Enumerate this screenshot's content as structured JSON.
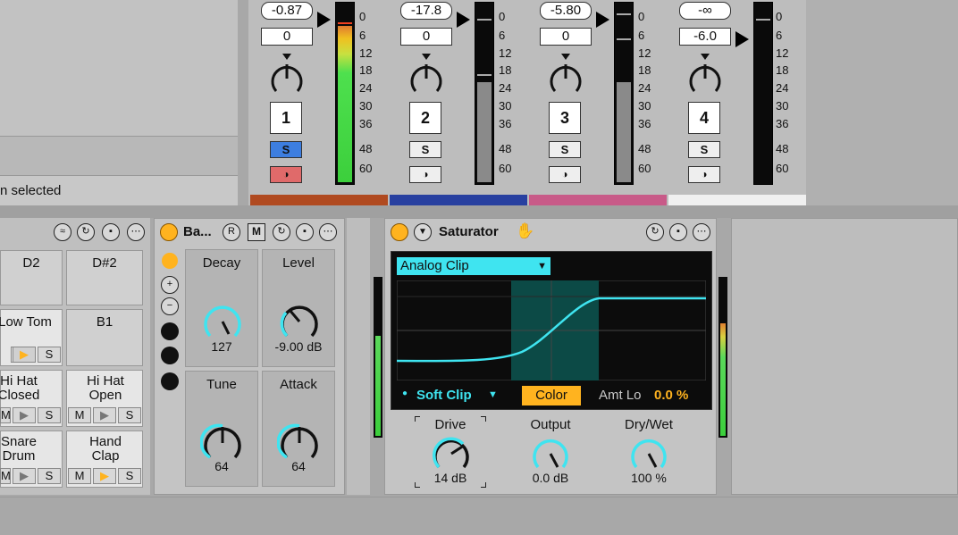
{
  "browser": {
    "status": "n selected"
  },
  "mixer": {
    "channels": [
      {
        "volume": "-0.87",
        "pan": "0",
        "number": "1",
        "solo": "S",
        "rec": "◑",
        "solo_active": true,
        "rec_active": true,
        "color": "#b04a20",
        "level": 0.9
      },
      {
        "volume": "-17.8",
        "pan": "0",
        "number": "2",
        "solo": "S",
        "rec": "◑",
        "solo_active": false,
        "rec_active": false,
        "color": "#2840a0",
        "level": 0.6
      },
      {
        "volume": "-5.80",
        "pan": "0",
        "number": "3",
        "solo": "S",
        "rec": "◑",
        "solo_active": false,
        "rec_active": false,
        "color": "#c85a88",
        "level": 0.6
      },
      {
        "volume": "-∞",
        "pan": "-6.0",
        "number": "4",
        "solo": "S",
        "rec": "◑",
        "solo_active": false,
        "rec_active": false,
        "color": "#f0f0f0",
        "level": 0
      }
    ],
    "scale": [
      "0",
      "6",
      "12",
      "18",
      "24",
      "30",
      "36",
      "48",
      "60"
    ]
  },
  "drum_rack": {
    "pads": [
      {
        "name": "D2"
      },
      {
        "name": "D#2"
      },
      {
        "name": "Low Tom"
      },
      {
        "name": "B1"
      },
      {
        "name": "Hi Hat Closed"
      },
      {
        "name": "Hi Hat Open"
      },
      {
        "name": "Snare Drum"
      },
      {
        "name": "Hand Clap"
      }
    ],
    "m": "M",
    "s": "S"
  },
  "bass_device": {
    "title": "Ba...",
    "r": "R",
    "m": "M",
    "knobs": [
      {
        "label": "Decay",
        "value": "127"
      },
      {
        "label": "Level",
        "value": "-9.00 dB"
      },
      {
        "label": "Tune",
        "value": "64"
      },
      {
        "label": "Attack",
        "value": "64"
      }
    ]
  },
  "saturator": {
    "title": "Saturator",
    "mode": "Analog Clip",
    "soft_clip": "Soft Clip",
    "color_button": "Color",
    "amt_lo_label": "Amt Lo",
    "amt_lo_value": "0.0 %",
    "knobs": [
      {
        "label": "Drive",
        "value": "14 dB"
      },
      {
        "label": "Output",
        "value": "0.0 dB"
      },
      {
        "label": "Dry/Wet",
        "value": "100 %"
      }
    ]
  },
  "colors": {
    "accent_cyan": "#3fe4f0",
    "orange": "#ffb31f",
    "solo_blue": "#3d7ee0",
    "rec_red": "#e06a6a"
  }
}
